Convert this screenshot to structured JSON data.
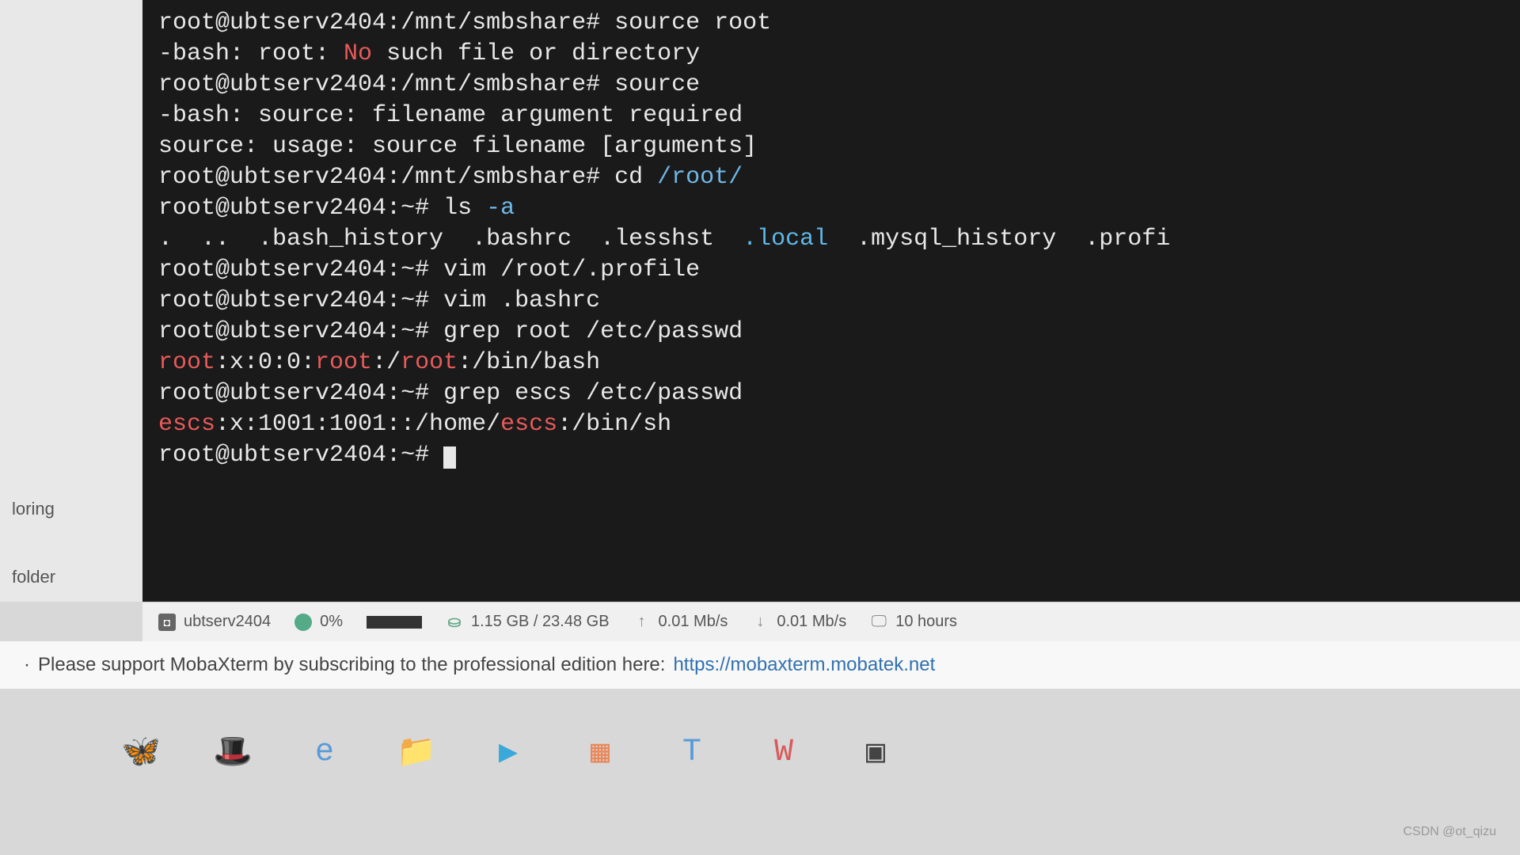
{
  "terminal": {
    "lines": [
      {
        "type": "prompt",
        "user": "root",
        "host": "ubtserv2404",
        "path": "/mnt/smbshare",
        "symbol": "#",
        "cmd": "source root"
      },
      {
        "type": "error",
        "prefix": "-bash: root: ",
        "highlight": "No",
        "suffix": " such file or directory"
      },
      {
        "type": "prompt",
        "user": "root",
        "host": "ubtserv2404",
        "path": "/mnt/smbshare",
        "symbol": "#",
        "cmd": "source"
      },
      {
        "type": "plain",
        "text": "-bash: source: filename argument required"
      },
      {
        "type": "plain",
        "text": "source: usage: source filename [arguments]"
      },
      {
        "type": "prompt",
        "user": "root",
        "host": "ubtserv2404",
        "path": "/mnt/smbshare",
        "symbol": "#",
        "cmd": "cd ",
        "dir_arg": "/root/"
      },
      {
        "type": "prompt",
        "user": "root",
        "host": "ubtserv2404",
        "path": "~",
        "symbol": "#",
        "cmd": "ls ",
        "flag": "-a"
      },
      {
        "type": "ls",
        "pre": ".  ..  .bash_history  .bashrc  .lesshst  ",
        "dir": ".local",
        "post": "  .mysql_history  .profi"
      },
      {
        "type": "prompt",
        "user": "root",
        "host": "ubtserv2404",
        "path": "~",
        "symbol": "#",
        "cmd": "vim /root/.profile"
      },
      {
        "type": "prompt",
        "user": "root",
        "host": "ubtserv2404",
        "path": "~",
        "symbol": "#",
        "cmd": "vim .bashrc"
      },
      {
        "type": "prompt",
        "user": "root",
        "host": "ubtserv2404",
        "path": "~",
        "symbol": "#",
        "cmd": "grep root /etc/passwd"
      },
      {
        "type": "grep",
        "segments": [
          {
            "t": "root",
            "m": true
          },
          {
            "t": ":x:0:0:",
            "m": false
          },
          {
            "t": "root",
            "m": true
          },
          {
            "t": ":/",
            "m": false
          },
          {
            "t": "root",
            "m": true
          },
          {
            "t": ":/bin/bash",
            "m": false
          }
        ]
      },
      {
        "type": "prompt",
        "user": "root",
        "host": "ubtserv2404",
        "path": "~",
        "symbol": "#",
        "cmd": "grep escs /etc/passwd"
      },
      {
        "type": "grep",
        "segments": [
          {
            "t": "escs",
            "m": true
          },
          {
            "t": ":x:1001:1001::/home/",
            "m": false
          },
          {
            "t": "escs",
            "m": true
          },
          {
            "t": ":/bin/sh",
            "m": false
          }
        ]
      },
      {
        "type": "prompt",
        "user": "root",
        "host": "ubtserv2404",
        "path": "~",
        "symbol": "#",
        "cmd": "",
        "cursor": true
      }
    ]
  },
  "sidebar": {
    "items": [
      "loring",
      "folder"
    ]
  },
  "status": {
    "hostname": "ubtserv2404",
    "cpu": "0%",
    "mem": "1.15 GB / 23.48 GB",
    "upload": "0.01 Mb/s",
    "download": "0.01 Mb/s",
    "uptime": "10 hours"
  },
  "support": {
    "bullet": "·",
    "text": "Please support MobaXterm by subscribing to the professional edition here:",
    "link": "https://mobaxterm.mobatek.net"
  },
  "taskbar": {
    "icons": [
      {
        "name": "butterfly-icon",
        "glyph": "🦋",
        "color": "#e85a9a"
      },
      {
        "name": "hat-icon",
        "glyph": "🎩",
        "color": "#4a6aaa"
      },
      {
        "name": "edge-icon",
        "glyph": "e",
        "color": "#5a9ad8"
      },
      {
        "name": "folder-icon",
        "glyph": "📁",
        "color": "#e8a84a"
      },
      {
        "name": "play-icon",
        "glyph": "▶",
        "color": "#3aa8d8"
      },
      {
        "name": "grid-icon",
        "glyph": "▦",
        "color": "#e8885a"
      },
      {
        "name": "t-icon",
        "glyph": "T",
        "color": "#5a9ad8"
      },
      {
        "name": "w-icon",
        "glyph": "W",
        "color": "#d85a5a"
      },
      {
        "name": "terminal-icon",
        "glyph": "▣",
        "color": "#444"
      }
    ]
  },
  "watermark": "CSDN @ot_qizu"
}
